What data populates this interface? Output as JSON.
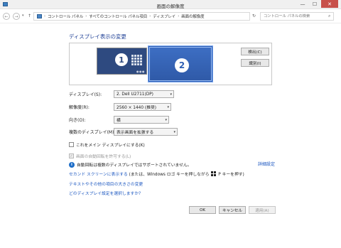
{
  "window": {
    "title": "画面の解像度",
    "minimize": "—",
    "maximize": "☐",
    "close": "✕"
  },
  "nav": {
    "back": "←",
    "forward": "→",
    "history": "▾",
    "up": "↑",
    "breadcrumbs": [
      "コントロール パネル",
      "すべてのコントロール パネル項目",
      "ディスプレイ",
      "画面の解像度"
    ],
    "separator": "›",
    "dropdown": "▾",
    "refresh": "↻",
    "search_placeholder": "コントロール パネルの検索",
    "search_icon": "⌕"
  },
  "main": {
    "title": "ディスプレイ表示の変更",
    "monitor1": {
      "number": "1",
      "status": "●●●"
    },
    "monitor2": {
      "number": "2"
    },
    "detect_button": "検出(C)",
    "identify_button": "識別(I)",
    "display_label": "ディスプレイ(S):",
    "display_value": "2. Dell U2711(DP)",
    "resolution_label": "解像度(R):",
    "resolution_value": "2560 × 1440 (推奨)",
    "orientation_label": "向き(O):",
    "orientation_value": "横",
    "multi_label": "複数のディスプレイ(M):",
    "multi_value": "表示画面を拡張する",
    "combo_arrow": "▾",
    "main_display_checkbox": "これをメイン ディスプレイにする(K)",
    "auto_rotate_checkbox": "画面の自動回転を許可する(L)",
    "auto_rotate_check": "✓",
    "info_icon": "i",
    "info_text": "自動回転は複数のディスプレイではサポートされていません。",
    "advanced_link": "詳細設定",
    "second_screen_link": "セカンド スクリーンに表示する",
    "second_screen_text_pre": "(または、Windows ロゴ キーを押しながら",
    "second_screen_text_post": "P キーを押す)",
    "text_size_link": "テキストやその他の項目の大きさの変更",
    "which_settings_link": "どのディスプレイ設定を選択しますか?"
  },
  "footer": {
    "ok": "OK",
    "cancel": "キャンセル",
    "apply": "適用(A)"
  }
}
